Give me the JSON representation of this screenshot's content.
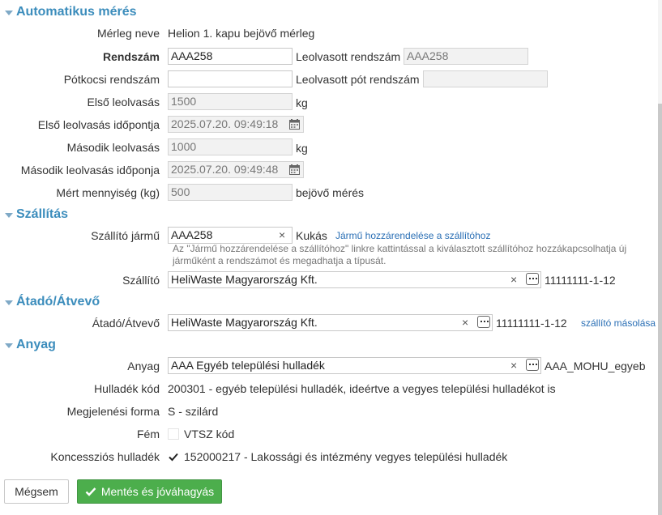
{
  "sections": {
    "automatic": "Automatikus mérés",
    "transport": "Szállítás",
    "handover": "Átadó/Átvevő",
    "material": "Anyag"
  },
  "scale": {
    "name_label": "Mérleg neve",
    "name_value": "Helion 1. kapu bejövő mérleg",
    "plate_label": "Rendszám",
    "plate_value": "AAA258",
    "read_plate_label": "Leolvasott rendszám",
    "read_plate_value": "AAA258",
    "trailer_label": "Pótkocsi rendszám",
    "trailer_value": "",
    "read_trailer_label": "Leolvasott pót rendszám",
    "read_trailer_value": "",
    "first_read_label": "Első leolvasás",
    "first_read_value": "1500",
    "first_unit": "kg",
    "first_time_label": "Első leolvasás időpontja",
    "first_time_value": "2025.07.20. 09:49:18",
    "second_read_label": "Második leolvasás",
    "second_read_value": "1000",
    "second_unit": "kg",
    "second_time_label": "Második leolvasás időponja",
    "second_time_value": "2025.07.20. 09:49:48",
    "measured_label": "Mért mennyiség (kg)",
    "measured_value": "500",
    "measured_note": "bejövő mérés"
  },
  "transport": {
    "vehicle_label": "Szállító jármű",
    "vehicle_value": "AAA258",
    "vehicle_type": "Kukás",
    "assign_link": "Jármű hozzárendelése a szállítóhoz",
    "hint": "Az \"Jármű hozzárendelése a szállítóhoz\" linkre kattintással a kiválasztott szállítóhoz hozzákapcsolhatja új járműként a rendszámot és megadhatja a típusát.",
    "carrier_label": "Szállító",
    "carrier_value": "HeliWaste Magyarország Kft.",
    "carrier_tax": "11111111-1-12"
  },
  "handover": {
    "label": "Átadó/Átvevő",
    "value": "HeliWaste Magyarország Kft.",
    "tax": "11111111-1-12",
    "copy_link": "szállító másolása"
  },
  "material": {
    "label": "Anyag",
    "value": "AAA Egyéb települési hulladék",
    "code": "AAA_MOHU_egyeb",
    "waste_code_label": "Hulladék kód",
    "waste_code_value": "200301 - egyéb települési hulladék, ideértve a vegyes települési hulladékot is",
    "form_label": "Megjelenési forma",
    "form_value": "S - szilárd",
    "metal_label": "Fém",
    "metal_value": "VTSZ kód",
    "metal_checked": false,
    "concession_label": "Koncessziós hulladék",
    "concession_value": "152000217 - Lakossági és intézmény vegyes települési hulladék",
    "concession_checked": true
  },
  "buttons": {
    "cancel": "Mégsem",
    "save": "Mentés és jóváhagyás"
  },
  "icons": {
    "section_toggle": "caret-down-icon",
    "calendar": "calendar-icon",
    "clear": "clear-x-icon",
    "lookup": "ellipsis-icon",
    "check": "check-icon"
  },
  "colors": {
    "section_title": "#3c8dbc",
    "link": "#2a6fb5",
    "primary_button": "#4cae4c"
  }
}
